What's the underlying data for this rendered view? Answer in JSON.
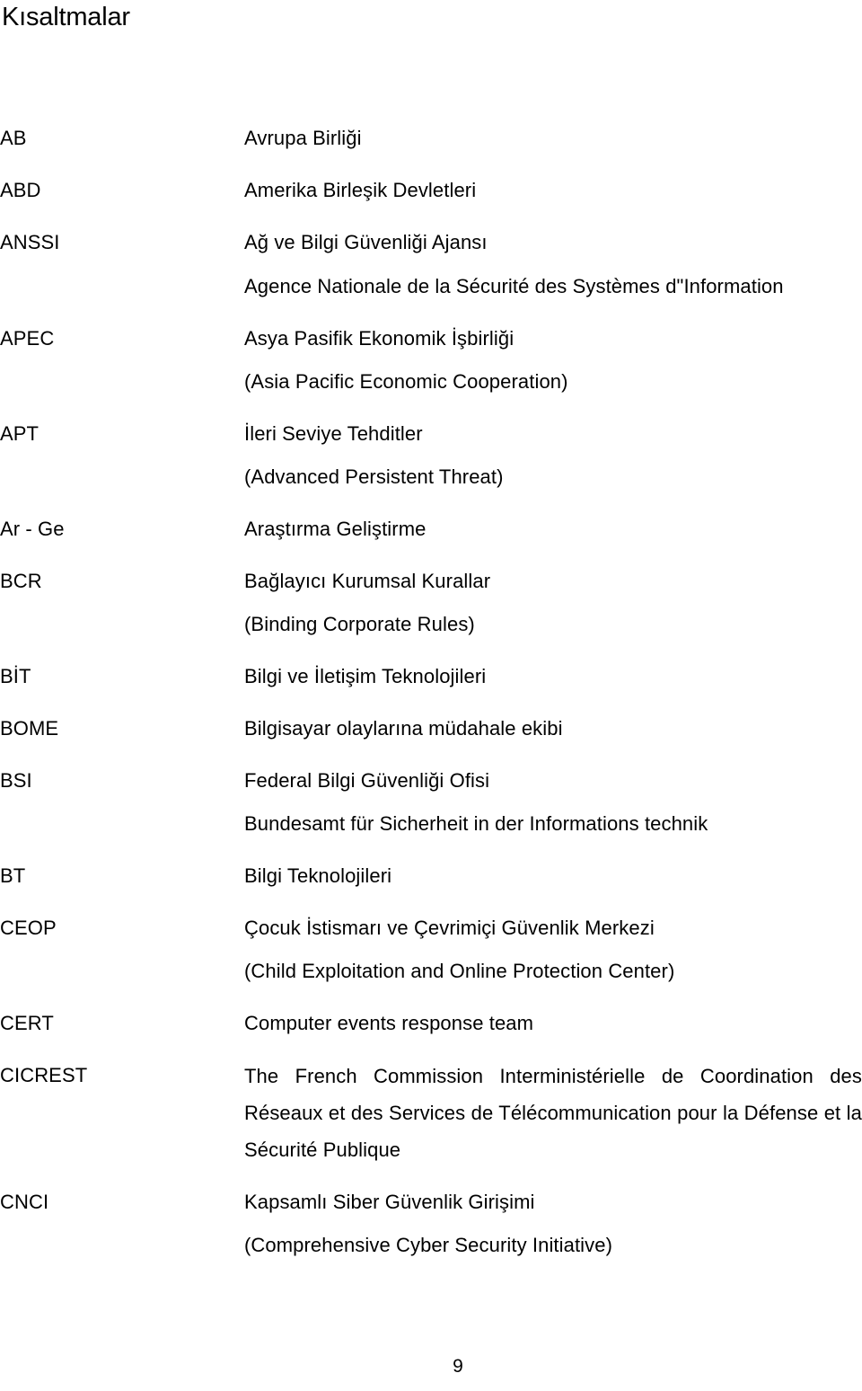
{
  "document": {
    "title": "Kısaltmalar",
    "page_number": "9"
  },
  "entries": [
    {
      "abbr": "AB",
      "lines": [
        "Avrupa Birliği"
      ]
    },
    {
      "abbr": "ABD",
      "lines": [
        "Amerika Birleşik Devletleri"
      ]
    },
    {
      "abbr": "ANSSI",
      "lines": [
        "Ağ ve Bilgi Güvenliği Ajansı"
      ],
      "justified": "Agence Nationale de la Sécurité des Systèmes d\"Information"
    },
    {
      "abbr": "APEC",
      "lines": [
        "Asya Pasifik Ekonomik İşbirliği",
        "(Asia Pacific Economic Cooperation)"
      ]
    },
    {
      "abbr": "APT",
      "lines": [
        "İleri Seviye Tehditler",
        "(Advanced Persistent Threat)"
      ]
    },
    {
      "abbr": "Ar - Ge",
      "lines": [
        "Araştırma Geliştirme"
      ]
    },
    {
      "abbr": "BCR",
      "lines": [
        "Bağlayıcı Kurumsal Kurallar",
        "(Binding Corporate Rules)"
      ]
    },
    {
      "abbr": "BİT",
      "lines": [
        "Bilgi ve İletişim Teknolojileri"
      ]
    },
    {
      "abbr": "BOME",
      "lines": [
        "Bilgisayar olaylarına müdahale ekibi"
      ]
    },
    {
      "abbr": "BSI",
      "lines": [
        "Federal Bilgi Güvenliği Ofisi",
        "Bundesamt für Sicherheit in der Informations technik"
      ]
    },
    {
      "abbr": "BT",
      "lines": [
        "Bilgi Teknolojileri"
      ]
    },
    {
      "abbr": "CEOP",
      "lines": [
        "Çocuk İstismarı ve Çevrimiçi Güvenlik Merkezi",
        "(Child Exploitation and Online Protection Center)"
      ]
    },
    {
      "abbr": "CERT",
      "lines": [
        "Computer events response team"
      ]
    },
    {
      "abbr": "CICREST",
      "justified": "The French Commission Interministérielle de Coordination des Réseaux et des Services de Télécommunication pour la Défense et la Sécurité Publique"
    },
    {
      "abbr": "CNCI",
      "lines": [
        "Kapsamlı Siber Güvenlik Girişimi",
        "(Comprehensive Cyber Security Initiative)"
      ]
    }
  ]
}
